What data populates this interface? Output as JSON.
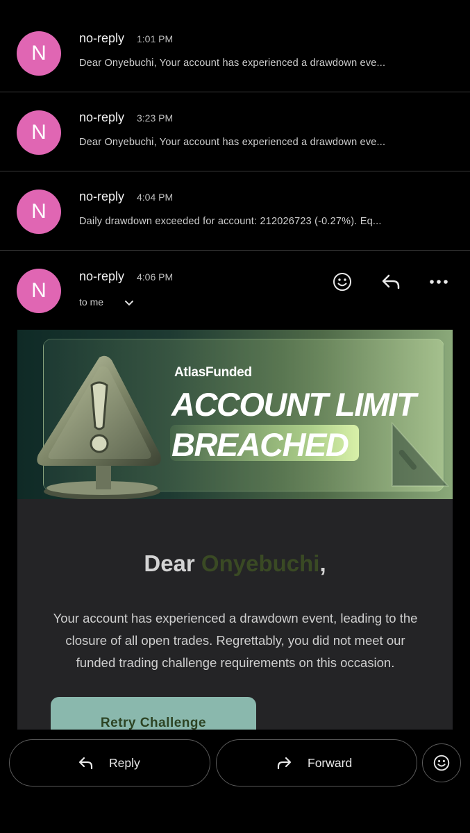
{
  "threads": [
    {
      "initial": "N",
      "sender": "no-reply",
      "time": "1:01 PM",
      "snippet": "Dear Onyebuchi, Your account has experienced a drawdown eve..."
    },
    {
      "initial": "N",
      "sender": "no-reply",
      "time": "3:23 PM",
      "snippet": "Dear Onyebuchi, Your account has experienced a drawdown eve..."
    },
    {
      "initial": "N",
      "sender": "no-reply",
      "time": "4:04 PM",
      "snippet": "Daily drawdown exceeded for account: 212026723 (-0.27%). Eq..."
    }
  ],
  "open_email": {
    "initial": "N",
    "sender": "no-reply",
    "time": "4:06 PM",
    "recipient": "to me",
    "icons": {
      "react": "emoji-icon",
      "reply": "reply-icon",
      "more": "more-icon"
    }
  },
  "banner": {
    "brand": "AtlasFunded",
    "title_line1": "ACCOUNT LIMIT",
    "title_line2": "BREACHED"
  },
  "email_body": {
    "greeting_prefix": "Dear ",
    "greeting_name": "Onyebuchi",
    "greeting_suffix": ",",
    "paragraph": "Your account has experienced a drawdown event, leading to the closure of all open trades. Regrettably, you did not meet our funded trading challenge requirements on this occasion.",
    "cta_label": "Retry Challenge"
  },
  "actions": {
    "reply_label": "Reply",
    "forward_label": "Forward"
  },
  "colors": {
    "avatar": "#e066b3",
    "name_accent": "#3a4a24",
    "cta_bg": "#8ab8ad",
    "cta_text": "#2d4424"
  }
}
